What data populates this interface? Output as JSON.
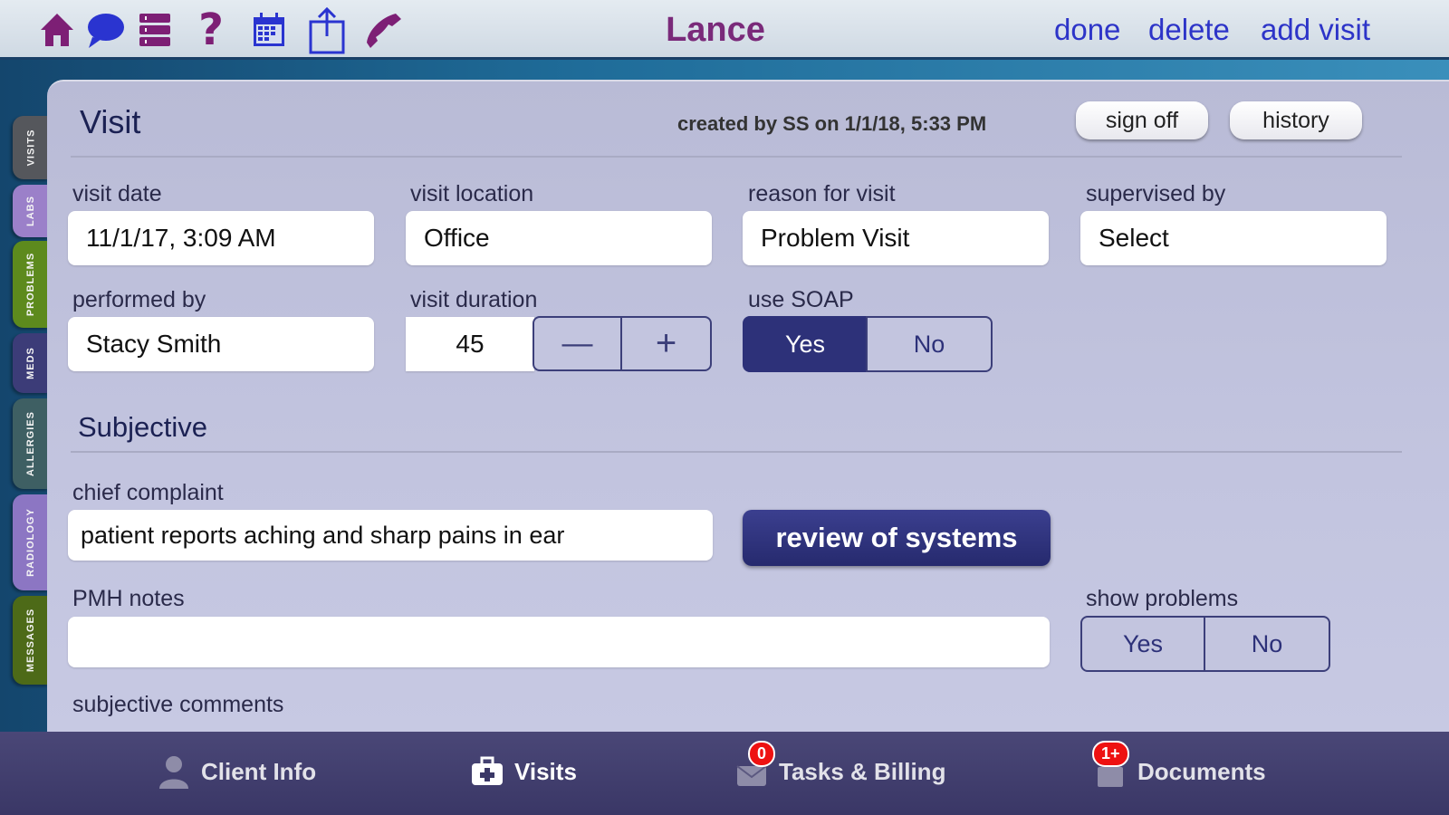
{
  "header": {
    "title": "Lance",
    "links": {
      "done": "done",
      "delete": "delete",
      "add_visit": "add visit"
    },
    "icons": [
      "home-icon",
      "chat-icon",
      "list-icon",
      "help-icon",
      "calendar-icon",
      "share-icon",
      "phone-icon"
    ]
  },
  "sidebar": {
    "tabs": [
      {
        "label": "VISITS",
        "color": "#55575c"
      },
      {
        "label": "LABS",
        "color": "#9b80c9"
      },
      {
        "label": "PROBLEMS",
        "color": "#5d8a1d"
      },
      {
        "label": "MEDS",
        "color": "#3c3c78"
      },
      {
        "label": "ALLERGIES",
        "color": "#3e5f63"
      },
      {
        "label": "RADIOLOGY",
        "color": "#8c76c3"
      },
      {
        "label": "MESSAGES",
        "color": "#4d6a18"
      }
    ]
  },
  "visit": {
    "title": "Visit",
    "created": "created by SS on 1/1/18, 5:33 PM",
    "sign_off": "sign off",
    "history": "history",
    "fields": {
      "visit_date": {
        "label": "visit date",
        "value": "11/1/17, 3:09 AM"
      },
      "visit_location": {
        "label": "visit location",
        "value": "Office"
      },
      "reason": {
        "label": "reason for visit",
        "value": "Problem Visit"
      },
      "supervised_by": {
        "label": "supervised by",
        "value": "Select"
      },
      "performed_by": {
        "label": "performed by",
        "value": "Stacy Smith"
      },
      "duration": {
        "label": "visit duration",
        "value": "45",
        "minus": "—",
        "plus": "+"
      },
      "use_soap": {
        "label": "use SOAP",
        "yes": "Yes",
        "no": "No",
        "selected": "Yes"
      }
    },
    "subjective": {
      "heading": "Subjective",
      "chief_complaint": {
        "label": "chief complaint",
        "value": "patient reports aching and sharp pains in ear"
      },
      "review_button": "review of systems",
      "pmh_notes": {
        "label": "PMH notes",
        "value": ""
      },
      "show_problems": {
        "label": "show problems",
        "yes": "Yes",
        "no": "No"
      },
      "comments_label": "subjective comments"
    }
  },
  "bottom_nav": {
    "items": [
      {
        "label": "Client Info",
        "icon": "person-icon",
        "badge": ""
      },
      {
        "label": "Visits",
        "icon": "medical-bag-icon",
        "badge": ""
      },
      {
        "label": "Tasks & Billing",
        "icon": "tasks-icon",
        "badge": "0"
      },
      {
        "label": "Documents",
        "icon": "documents-icon",
        "badge": "1+"
      }
    ]
  },
  "colors": {
    "accent": "#2b2f7a",
    "title": "#7a2a7a",
    "link": "#2d34c8"
  }
}
